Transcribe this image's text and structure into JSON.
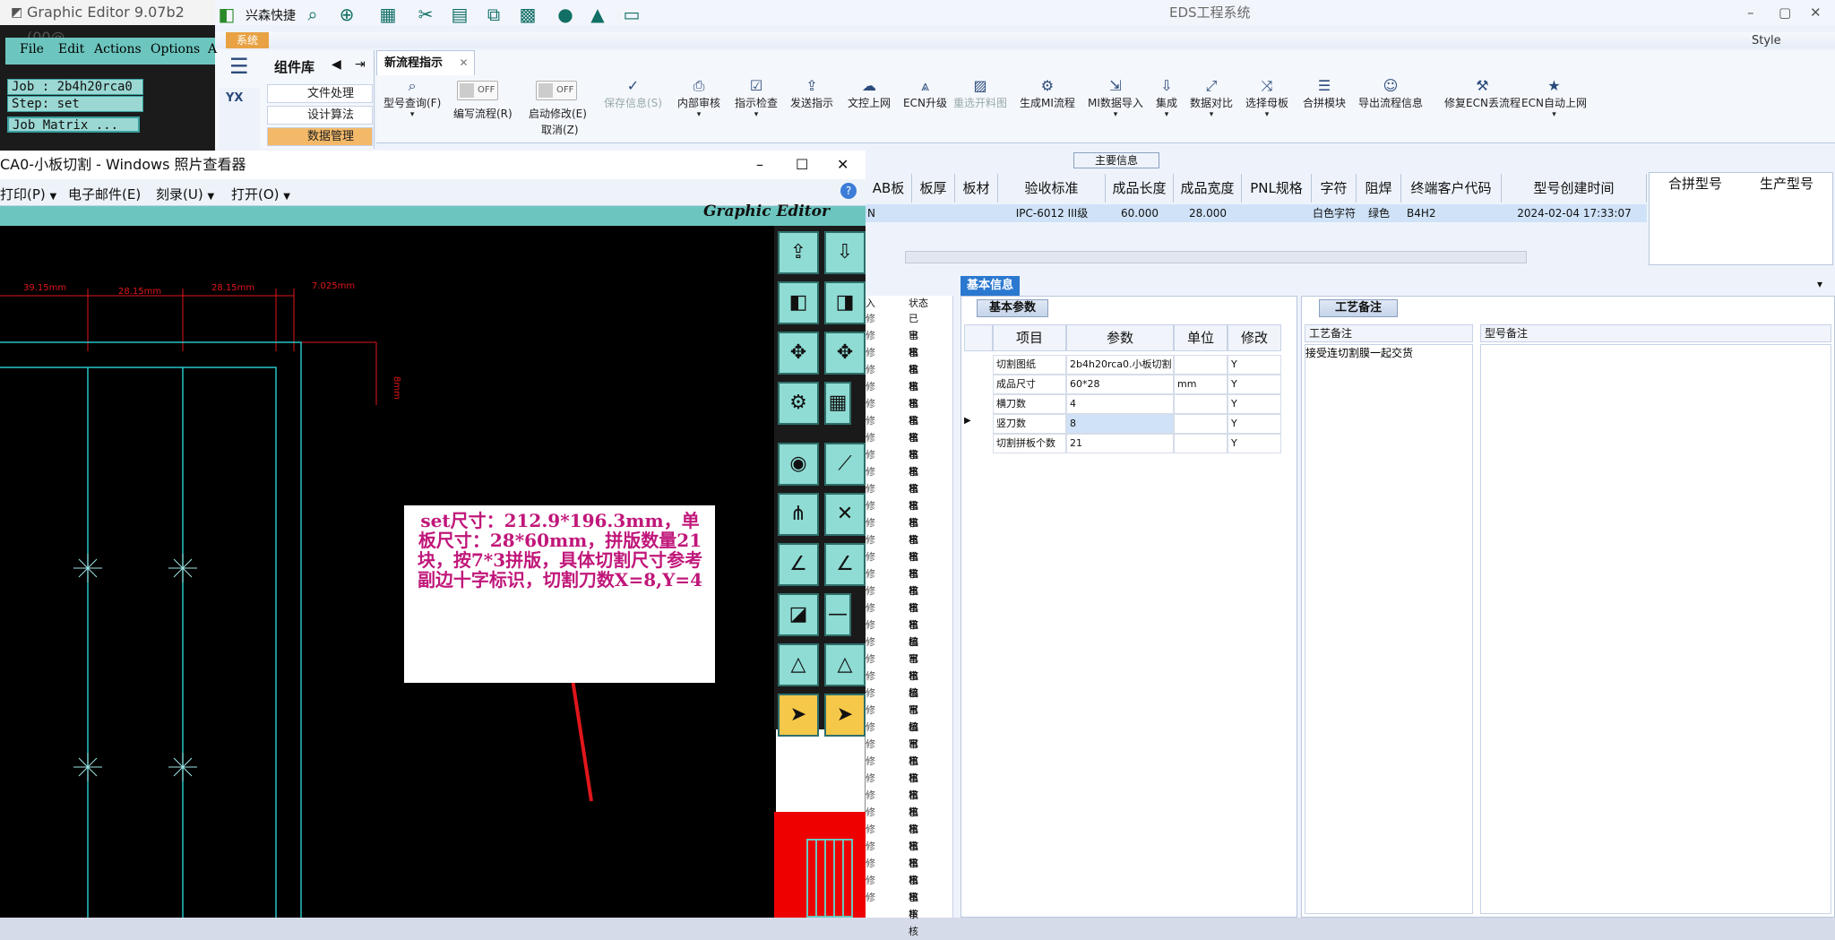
{
  "eds": {
    "window_title": "EDS工程系统",
    "quick_launch": "兴森快捷",
    "sys_tab": "系统",
    "style_label": "Style",
    "component_library": {
      "title": "组件库",
      "items": [
        "文件处理",
        "设计算法",
        "数据管理"
      ]
    },
    "doc_tab": "新流程指示",
    "ribbon": [
      {
        "label": "型号查询(F)",
        "icon": "search-icon"
      },
      {
        "label": "编写流程(R)",
        "icon": "toggle-off"
      },
      {
        "label": "启动修改(E)",
        "icon": "toggle-off"
      },
      {
        "label": "保存信息(S)",
        "icon": "check-icon"
      },
      {
        "label": "内部审核",
        "icon": "printer-icon"
      },
      {
        "label": "指示检查",
        "icon": "checklist-icon"
      },
      {
        "label": "发送指示",
        "icon": "upload-icon"
      },
      {
        "label": "文控上网",
        "icon": "cloud-upload-icon"
      },
      {
        "label": "ECN升级",
        "icon": "ecn-icon"
      },
      {
        "label": "重选开料图",
        "icon": "image-icon"
      },
      {
        "label": "生成MI流程",
        "icon": "gears-icon"
      },
      {
        "label": "MI数据导入",
        "icon": "import-icon"
      },
      {
        "label": "集成",
        "icon": "download-icon"
      },
      {
        "label": "数据对比",
        "icon": "compare-icon"
      },
      {
        "label": "选择母板",
        "icon": "shuffle-icon"
      },
      {
        "label": "合拼模块",
        "icon": "list-icon"
      },
      {
        "label": "导出流程信息",
        "icon": "smile-icon"
      },
      {
        "label": "修复ECN丢流程",
        "icon": "wrench-icon"
      },
      {
        "label": "ECN自动上网",
        "icon": "star-icon"
      }
    ],
    "toggle_off": "OFF",
    "cancel_label": "取消(Z)",
    "main_info_label": "主要信息",
    "grid": {
      "headers": [
        "AB板",
        "板厚",
        "板材",
        "验收标准",
        "成品长度",
        "成品宽度",
        "PNL规格",
        "字符",
        "阻焊",
        "终端客户代码",
        "型号创建时间"
      ],
      "row": [
        "",
        "",
        "",
        "IPC-6012 III级",
        "60.000",
        "28.000",
        "",
        "白色字符",
        "绿色",
        "B4H2",
        "2024-02-04 17:33:07"
      ],
      "row_lead": "N"
    },
    "merge_headers": [
      "合拼型号",
      "生产型号"
    ],
    "basic_info_tab": "基本信息",
    "params_tab": "基本参数",
    "params": {
      "headers": [
        "项目",
        "参数",
        "单位",
        "修改"
      ],
      "rows": [
        [
          "切割图纸",
          "2b4h20rca0.小板切割",
          "",
          "Y"
        ],
        [
          "成品尺寸",
          "60*28",
          "mm",
          "Y"
        ],
        [
          "横刀数",
          "4",
          "",
          "Y"
        ],
        [
          "竖刀数",
          "8",
          "",
          "Y"
        ],
        [
          "切割拼板个数",
          "21",
          "",
          "Y"
        ]
      ]
    },
    "craft_tab": "工艺备注",
    "craft_headers": [
      "工艺备注",
      "型号备注"
    ],
    "craft_note": "接受连切割膜一起交货",
    "status_header": "状态",
    "status_lead": "入",
    "status_values": [
      "已审核",
      "已审核",
      "已审核",
      "已审核",
      "已审核",
      "已审核",
      "已审核",
      "已审核",
      "已审核",
      "已审核",
      "已审核",
      "已审核",
      "已审核",
      "已审核",
      "已审核",
      "已审核",
      "已审核",
      "已审核",
      "已编写",
      "已审核",
      "已审核",
      "已编写",
      "已审核",
      "已编写",
      "已审核",
      "已审核",
      "已审核",
      "已审核",
      "已审核",
      "已审核",
      "已审核",
      "已审核",
      "已审核",
      "已审核",
      "已审核",
      "已审核",
      "已审核"
    ],
    "status_prefix": "修"
  },
  "graphic_editor": {
    "title": "Graphic Editor 9.07b2 (00@",
    "menu": [
      "File",
      "Edit",
      "Actions",
      "Options",
      "A"
    ],
    "job": "Job : 2b4h20rca0",
    "step": "Step: set",
    "matrix": "Job Matrix ...",
    "canvas_brand": "Graphic Editor"
  },
  "photo_viewer": {
    "title": "CA0-小板切割 - Windows 照片查看器",
    "menu": [
      "打印(P)",
      "电子邮件(E)",
      "刻录(U)",
      "打开(O)"
    ],
    "help": "?",
    "dims": [
      "39.15mm",
      "28.15mm",
      "28.15mm",
      "7.025mm",
      "8mm"
    ],
    "note": "set尺寸：212.9*196.3mm，单板尺寸：28*60mm，拼版数量21块，按7*3拼版，具体切割尺寸参考副边十字标识，切割刀数X=8,Y=4"
  },
  "colors": {
    "accent": "#2b78d0",
    "cad_bg": "#000000",
    "cad_teal": "#6cc6bf",
    "note_magenta": "#c0177a",
    "orange": "#e8a243"
  }
}
